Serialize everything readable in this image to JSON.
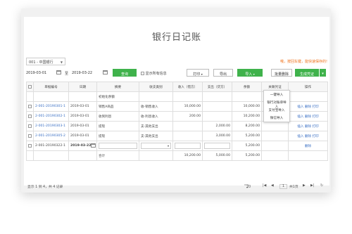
{
  "title": "银行日记账",
  "account_select": {
    "value": "001 - 中国银行"
  },
  "notice": "哦，按回车键，能快速保存的!",
  "date_range": {
    "start": "2019-03-01",
    "separator": "至",
    "end": "2019-03-22"
  },
  "toolbar": {
    "query_label": "查询",
    "show_all_label": "显示所有信息",
    "print_label": "打印",
    "export_label": "导出",
    "import_label": "导入",
    "batch_delete_label": "批量删除",
    "generate_voucher_label": "生成凭证"
  },
  "import_menu": [
    "一键导入",
    "银行对账单导入",
    "支付宝导入",
    "微信导入"
  ],
  "table": {
    "headers": [
      "单据编号",
      "日期",
      "摘要",
      "收支类别",
      "收入（借方）",
      "支出（贷方）",
      "余额",
      "关联凭证",
      "操作"
    ],
    "rows": [
      {
        "code": "",
        "date": "",
        "summary": "初始化余额",
        "category": "",
        "income": "",
        "expense": "",
        "balance": "",
        "voucher": "",
        "actions": []
      },
      {
        "code": "2-001-20190301-1",
        "date": "2019-03-01",
        "summary": "销售A商品",
        "category": "收-销售收入",
        "income": "10,000.00",
        "expense": "",
        "balance": "10,000.00",
        "voucher": "",
        "actions": [
          "插入",
          "删除",
          "打印"
        ]
      },
      {
        "code": "2-001-20190302-1",
        "date": "2019-03-01",
        "summary": "收到利息",
        "category": "收-利息收入",
        "income": "200.00",
        "expense": "",
        "balance": "10,200.00",
        "voucher": "",
        "actions": [
          "插入",
          "删除",
          "打印"
        ]
      },
      {
        "code": "2-001-20190303-1",
        "date": "2019-03-01",
        "summary": "提现",
        "category": "支-其他支出",
        "income": "",
        "expense": "2,000.00",
        "balance": "8,200.00",
        "voucher": "",
        "actions": [
          "插入",
          "删除",
          "打印"
        ]
      },
      {
        "code": "2-001-20190305-2",
        "date": "2019-03-01",
        "summary": "提现",
        "category": "支-其他支出",
        "income": "",
        "expense": "3,000.00",
        "balance": "5,200.00",
        "voucher": "",
        "actions": [
          "插入",
          "删除",
          "打印"
        ]
      },
      {
        "code": "2-001-20190322-1",
        "date": "2019-03-22",
        "summary": "",
        "category": "",
        "income": "",
        "expense": "",
        "balance": "5,200.00",
        "voucher": "",
        "actions": [
          "删除"
        ]
      }
    ],
    "total": {
      "label": "合计",
      "income": "10,200.00",
      "expense": "5,000.00",
      "balance": "5,200.00"
    }
  },
  "footer": {
    "summary": "显示 1 到 4，共 4 记录",
    "page_size": "20",
    "page_input": "1",
    "page_total": "共1页"
  }
}
